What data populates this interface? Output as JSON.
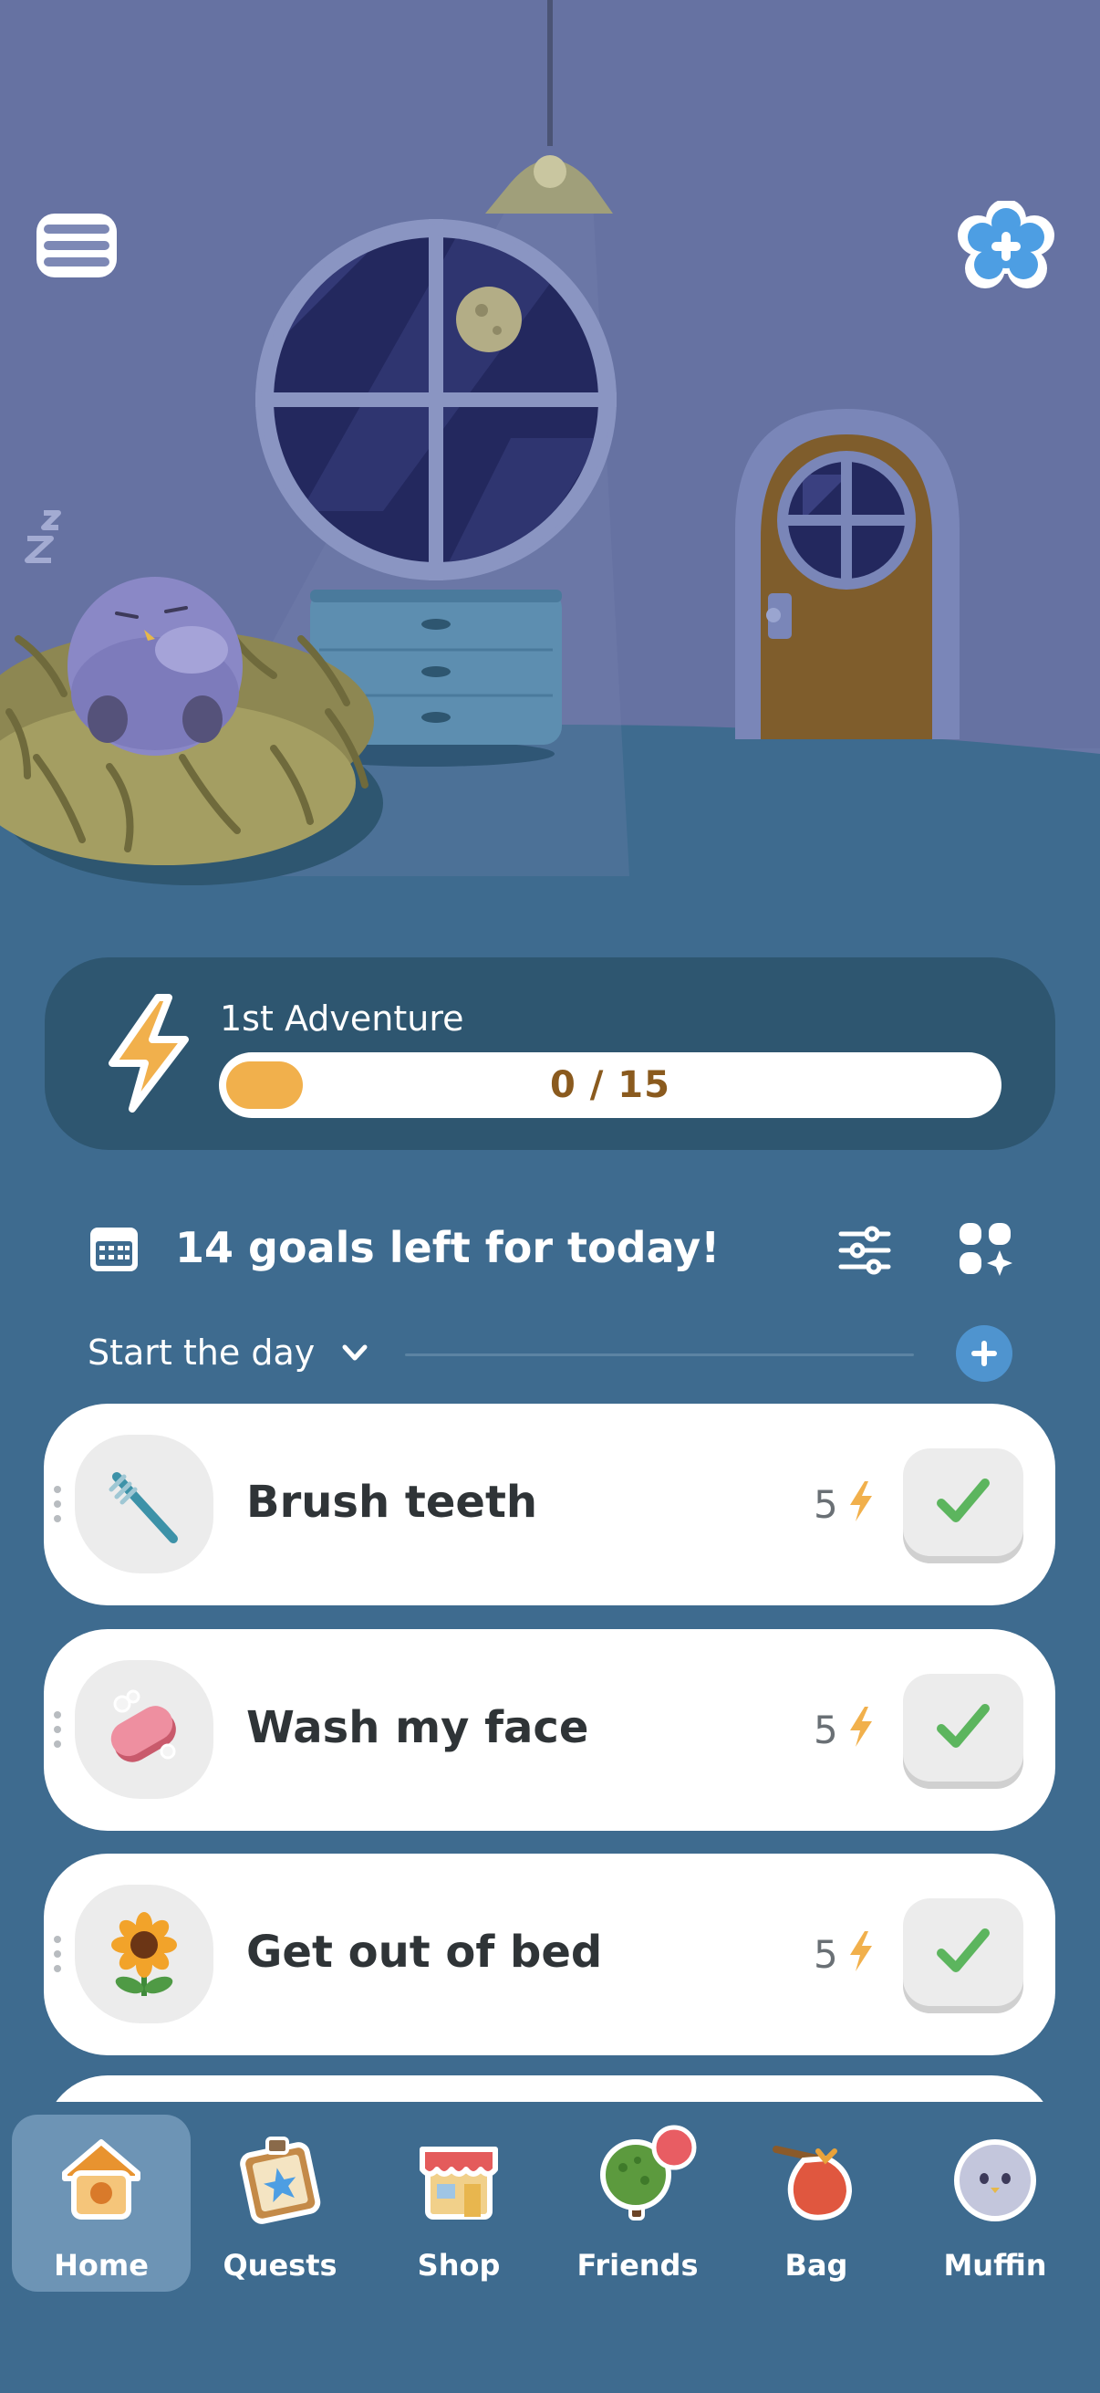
{
  "adventure": {
    "title": "1st Adventure",
    "progress_text": "0 / 15",
    "progress_value": 0,
    "progress_max": 15
  },
  "goals": {
    "header": "14 goals left for today!",
    "section": "Start the day",
    "items": [
      {
        "label": "Brush teeth",
        "points": "5",
        "icon": "toothbrush-icon"
      },
      {
        "label": "Wash my face",
        "points": "5",
        "icon": "soap-icon"
      },
      {
        "label": "Get out of bed",
        "points": "5",
        "icon": "sunflower-icon"
      }
    ]
  },
  "nav": {
    "items": [
      {
        "label": "Home",
        "icon": "house-icon",
        "active": true
      },
      {
        "label": "Quests",
        "icon": "quest-board-icon"
      },
      {
        "label": "Shop",
        "icon": "shop-icon"
      },
      {
        "label": "Friends",
        "icon": "tree-icon",
        "badge": true
      },
      {
        "label": "Bag",
        "icon": "bag-icon"
      },
      {
        "label": "Muffin",
        "icon": "pet-icon"
      }
    ]
  },
  "colors": {
    "background": "#3e6b8f",
    "wall": "#6a77a6",
    "accent": "#f1b04c",
    "check": "#5cb55e",
    "brand_blue": "#4f94cf"
  }
}
